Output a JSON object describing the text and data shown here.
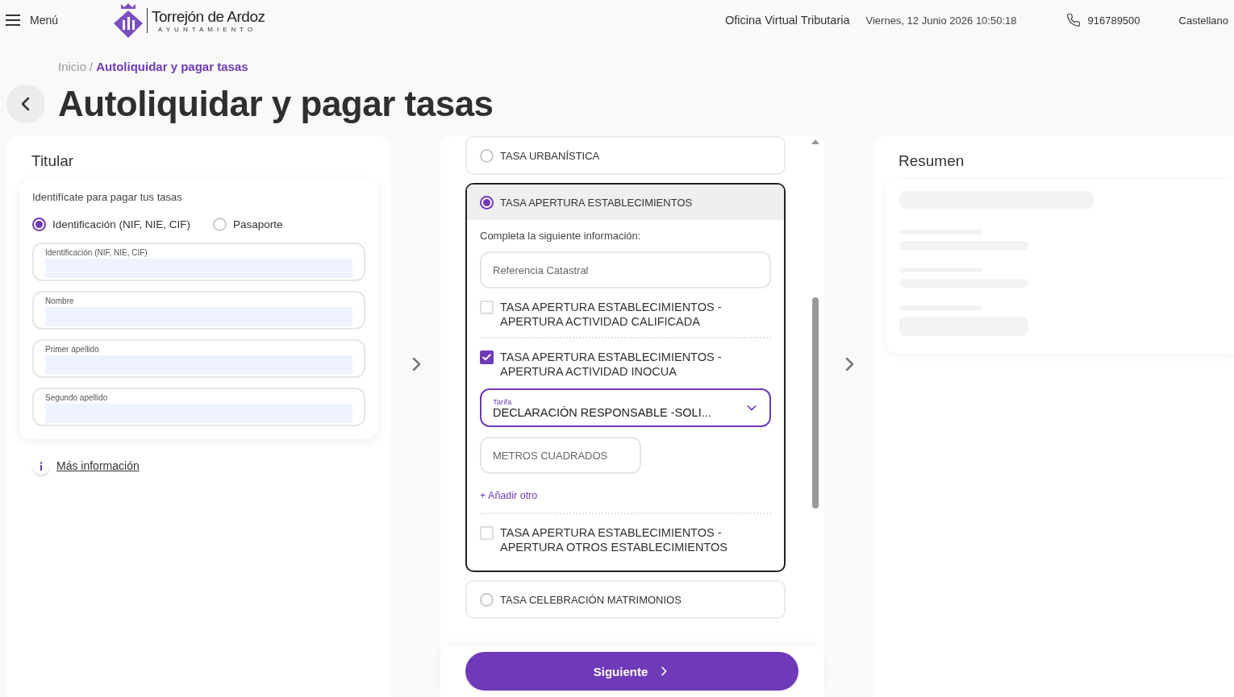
{
  "header": {
    "menu_label": "Menú",
    "logo": {
      "name": "Torrejón de Ardoz",
      "subtitle": "AYUNTAMIENTO"
    },
    "office": "Oficina Virtual Tributaria",
    "datetime": "Viernes, 12 Junio 2026 10:50:18",
    "phone": "916789500",
    "language": "Castellano"
  },
  "breadcrumb": [
    {
      "label": "Inicio",
      "current": false
    },
    {
      "label": "Autoliquidar y pagar tasas",
      "current": true
    }
  ],
  "breadcrumb_separator": "/",
  "title": "Autoliquidar y pagar tasas",
  "titular": {
    "title": "Titular",
    "intro": "Identifícate para pagar tus tasas",
    "id_options": [
      {
        "label": "Identificación (NIF, NIE, CIF)",
        "selected": true
      },
      {
        "label": "Pasaporte",
        "selected": false
      }
    ],
    "fields": [
      {
        "label": "Identificación (NIF, NIE, CIF)"
      },
      {
        "label": "Nombre"
      },
      {
        "label": "Primer apellido"
      },
      {
        "label": "Segundo apellido"
      }
    ],
    "more_info": "Más información"
  },
  "taxes": [
    {
      "label": "TASA URBANÍSTICA",
      "selected": false
    },
    {
      "label": "TASA APERTURA ESTABLECIMIENTOS",
      "selected": true,
      "details": {
        "intro": "Completa la siguiente información:",
        "reference_placeholder": "Referencia Catastral",
        "options": [
          {
            "label": "TASA APERTURA ESTABLECIMIENTOS - APERTURA ACTIVIDAD CALIFICADA",
            "checked": false
          },
          {
            "label": "TASA APERTURA ESTABLECIMIENTOS - APERTURA ACTIVIDAD INOCUA",
            "checked": true,
            "tariff": {
              "label": "Tarifa",
              "value": "DECLARACIÓN RESPONSABLE -SOLI..."
            },
            "area_placeholder": "METROS CUADRADOS",
            "add_link": "+ Añadir otro"
          },
          {
            "label": "TASA APERTURA ESTABLECIMIENTOS - APERTURA OTROS ESTABLECIMIENTOS",
            "checked": false
          }
        ]
      }
    },
    {
      "label": "TASA CELEBRACIÓN MATRIMONIOS",
      "selected": false
    }
  ],
  "summary": {
    "title": "Resumen"
  },
  "next_button": "Siguiente"
}
